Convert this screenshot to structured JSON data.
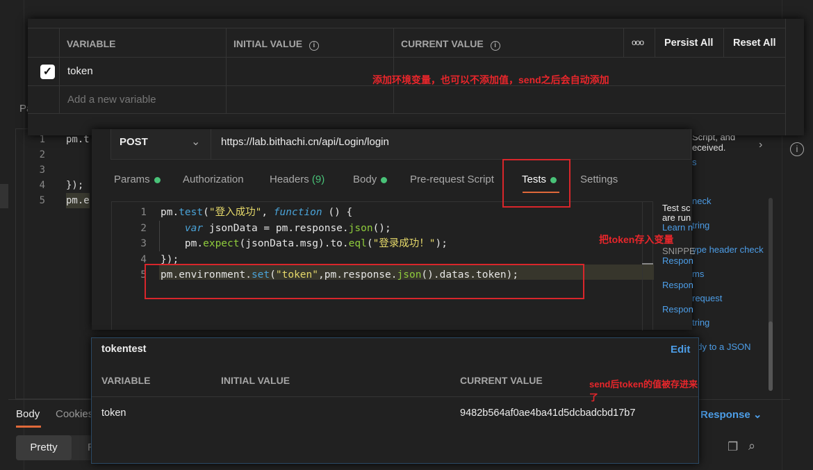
{
  "background": {
    "line_numbers": [
      "1",
      "2",
      "3",
      "4",
      "5"
    ],
    "code_fragments": [
      "pm.t",
      "",
      "",
      "});",
      "pm.e"
    ],
    "params_partial": "Pa",
    "response_tabs": {
      "body": "Body",
      "cookies": "Cookies"
    },
    "pretty": "Pretty",
    "raw_partial": "R",
    "save_response": "Response",
    "snippets_bg": [
      "Script, and",
      "eceived.",
      "s",
      "neck",
      "tring",
      "ype header check",
      "ms",
      "request",
      "tring",
      "ody to a JSON"
    ]
  },
  "env_editor": {
    "headers": {
      "variable": "VARIABLE",
      "initial": "INITIAL VALUE",
      "current": "CURRENT VALUE"
    },
    "more": "ooo",
    "persist_all": "Persist All",
    "reset_all": "Reset All",
    "rows": [
      {
        "checked": true,
        "variable": "token",
        "initial": "",
        "current": ""
      }
    ],
    "add_placeholder": "Add a new variable",
    "annotation": "添加环境变量，也可以不添加值，send之后会自动添加"
  },
  "request": {
    "method": "POST",
    "url": "https://lab.bithachi.cn/api/Login/login",
    "tabs": {
      "params": "Params",
      "authorization": "Authorization",
      "headers": "Headers",
      "headers_count": "(9)",
      "body": "Body",
      "prerequest": "Pre-request Script",
      "tests": "Tests",
      "settings": "Settings"
    },
    "annotation": "把token存入变量",
    "snippet_panel": {
      "desc1": "Test sc",
      "desc2": "are run",
      "learn": "Learn n",
      "snippets": "SNIPPE",
      "items": [
        "Respon",
        "Respon",
        "Respon"
      ]
    }
  },
  "env_quicklook": {
    "name": "tokentest",
    "edit": "Edit",
    "headers": {
      "variable": "VARIABLE",
      "initial": "INITIAL VALUE",
      "current": "CURRENT VALUE"
    },
    "rows": [
      {
        "variable": "token",
        "initial": "",
        "current": "9482b564af0ae4ba41d5dcbadcbd17b7"
      }
    ],
    "annotation": "send后token的值被存进来了"
  }
}
